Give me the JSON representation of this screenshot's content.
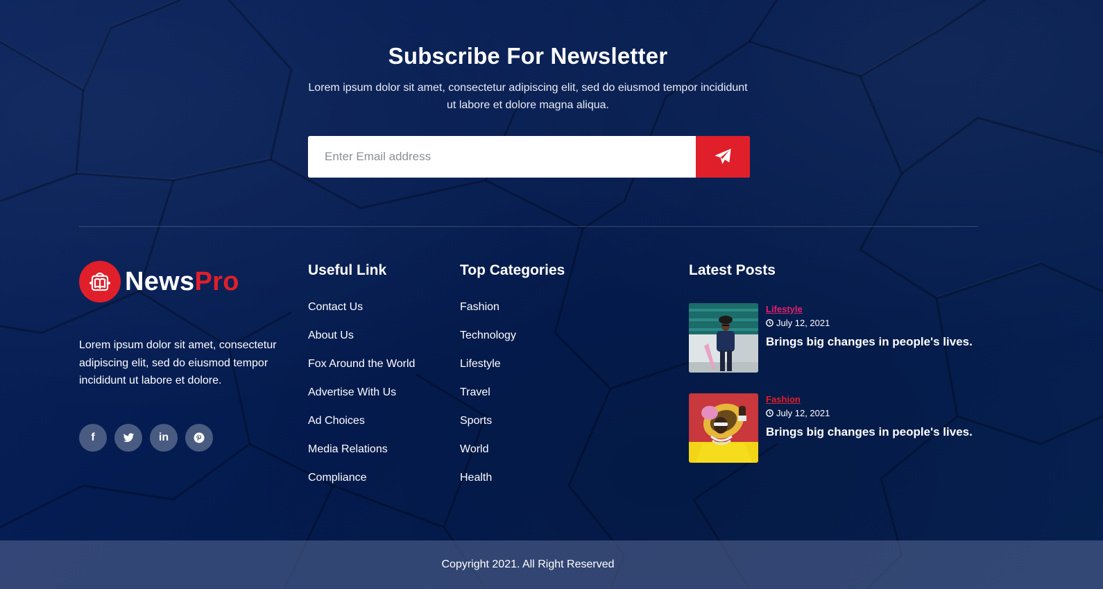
{
  "colors": {
    "background": "#041b4f",
    "accent": "#e01f2a",
    "category_pink": "#e6206b",
    "bottom_bar": "#3d4a73"
  },
  "newsletter": {
    "title": "Subscribe For Newsletter",
    "description": "Lorem ipsum dolor sit amet, consectetur adipiscing elit, sed do eiusmod tempor incididunt ut labore et dolore magna aliqua.",
    "email_placeholder": "Enter Email address",
    "submit_icon": "paper-plane-icon"
  },
  "brand": {
    "name_part1": "News",
    "name_part2": "Pro",
    "logo_icon": "book-bag-icon",
    "about": "Lorem ipsum dolor sit amet, consectetur adipiscing elit, sed do eiusmod tempor incididunt ut labore et dolore."
  },
  "socials": [
    {
      "name": "facebook",
      "icon": "facebook-icon",
      "glyph": "f"
    },
    {
      "name": "twitter",
      "icon": "twitter-icon",
      "glyph": ""
    },
    {
      "name": "linkedin",
      "icon": "linkedin-icon",
      "glyph": "in"
    },
    {
      "name": "pinterest",
      "icon": "pinterest-icon",
      "glyph": ""
    }
  ],
  "useful_links": {
    "title": "Useful Link",
    "items": [
      "Contact Us",
      "About Us",
      "Fox Around the World",
      "Advertise With Us",
      "Ad Choices",
      "Media Relations",
      "Compliance"
    ]
  },
  "top_categories": {
    "title": "Top Categories",
    "items": [
      "Fashion",
      "Technology",
      "Lifestyle",
      "Travel",
      "Sports",
      "World",
      "Health"
    ]
  },
  "latest_posts": {
    "title": "Latest Posts",
    "items": [
      {
        "category": "Lifestyle",
        "date": "July 12, 2021",
        "title": "Brings big changes in people's lives."
      },
      {
        "category": "Fashion",
        "date": "July 12, 2021",
        "title": "Brings big changes in people's lives."
      }
    ]
  },
  "footer": {
    "copyright": "Copyright 2021. All Right Reserved"
  }
}
